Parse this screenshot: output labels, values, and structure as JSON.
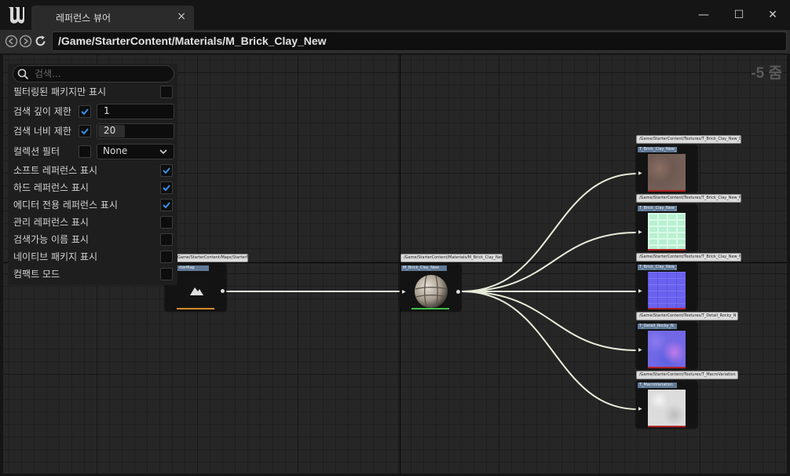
{
  "window": {
    "tab_title": "레퍼런스 뷰어",
    "tab_close": "×",
    "minimize": "—",
    "maximize": "☐",
    "close": "✕"
  },
  "nav": {
    "path": "/Game/StarterContent/Materials/M_Brick_Clay_New"
  },
  "graph": {
    "zoom_label": "-5 줌",
    "nodes": {
      "map": {
        "path": "Game/StarterContent/Maps/StarterMap",
        "name": "rterMap"
      },
      "material": {
        "path": "/Game/StarterContent/Materials/M_Brick_Clay_New",
        "name": "M_Brick_Clay_New"
      },
      "tex_d": {
        "path": "/Game/StarterContent/Textures/T_Brick_Clay_New_D",
        "name": "T_Brick_Clay_New_D"
      },
      "tex_m": {
        "path": "/Game/StarterContent/Textures/T_Brick_Clay_New_M",
        "name": "T_Brick_Clay_New_M"
      },
      "tex_n": {
        "path": "/Game/StarterContent/Textures/T_Brick_Clay_New_N",
        "name": "T_Brick_Clay_New_N"
      },
      "tex_rocky": {
        "path": "/Game/StarterContent/Textures/T_Detail_Rocky_N",
        "name": "T_Detail_Rocky_N"
      },
      "tex_macro": {
        "path": "/Game/StarterContent/Textures/T_MacroVariation",
        "name": "T_MacroVariation"
      }
    }
  },
  "filters": {
    "search_placeholder": "검색...",
    "only_filtered": {
      "label": "필터링된 패키지만 표시",
      "checked": false
    },
    "search_depth": {
      "label": "검색 깊이 제한",
      "checked": true,
      "value": "1"
    },
    "search_breadth": {
      "label": "검색 너비 제한",
      "checked": true,
      "value": "20"
    },
    "collection": {
      "label": "컬렉션 필터",
      "checked": false,
      "value": "None"
    },
    "soft_refs": {
      "label": "소프트 레퍼런스 표시",
      "checked": true
    },
    "hard_refs": {
      "label": "하드 레퍼런스 표시",
      "checked": true
    },
    "editor_refs": {
      "label": "에디터 전용 레퍼런스 표시",
      "checked": true
    },
    "management_refs": {
      "label": "관리 레퍼런스 표시",
      "checked": false
    },
    "searchable_names": {
      "label": "검색가능 이름 표시",
      "checked": false
    },
    "native_packages": {
      "label": "네이티브 패키지 표시",
      "checked": false
    },
    "compact_mode": {
      "label": "컴팩트 모드",
      "checked": false
    }
  },
  "colors": {
    "accent_check": "#3a8eea",
    "node_title": "#5f7996",
    "wire": "#e6ecd8"
  }
}
